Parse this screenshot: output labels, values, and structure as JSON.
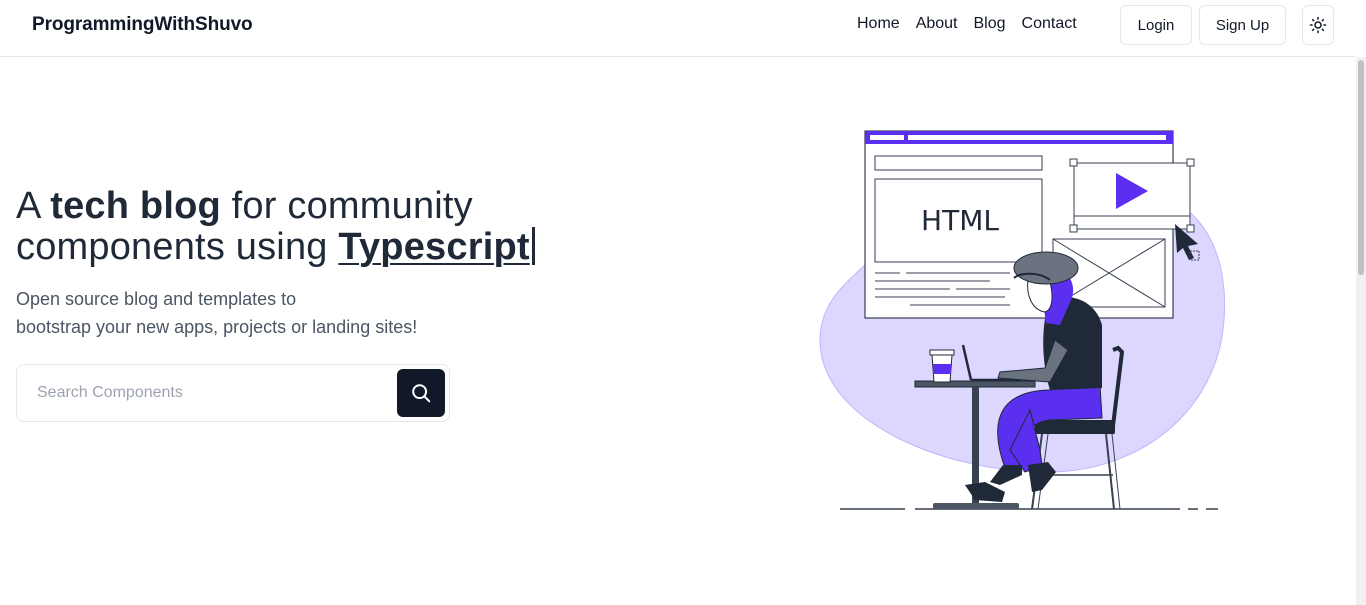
{
  "header": {
    "brand": "ProgrammingWithShuvo",
    "nav": [
      "Home",
      "About",
      "Blog",
      "Contact"
    ],
    "login_label": "Login",
    "signup_label": "Sign Up",
    "theme_icon": "sun-icon"
  },
  "hero": {
    "title_prefix": "A ",
    "title_bold": "tech blog",
    "title_mid": " for community components using ",
    "typed_word": "Typescript",
    "subtitle_line1": "Open source blog and templates to",
    "subtitle_line2": "bootstrap your new apps, projects or landing sites!"
  },
  "search": {
    "placeholder": "Search Components",
    "button_icon": "search-icon"
  },
  "illustration": {
    "editor_text": "HTML",
    "accent_color": "#5b2ff0",
    "blob_color": "#ddd6fe"
  }
}
